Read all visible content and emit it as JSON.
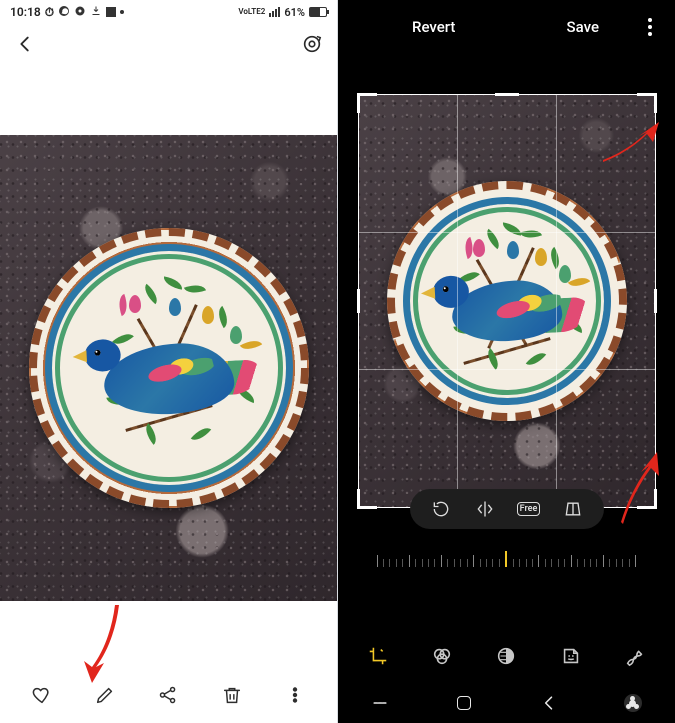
{
  "status": {
    "time": "10:18",
    "network_label": "VoLTE2",
    "signal_icon": "signal-icon",
    "battery_pct": "61%",
    "battery_icon": "battery-icon",
    "notif_icons": [
      "clock-icon",
      "whatsapp-icon",
      "disc-icon",
      "download-icon",
      "square-icon",
      "more-dot"
    ]
  },
  "left": {
    "back_icon": "chevron-left-icon",
    "bixby_icon": "bixby-vision-icon",
    "actions": {
      "favorite": "heart-icon",
      "edit": "pencil-icon",
      "share": "share-icon",
      "delete": "trash-icon",
      "more": "more-vertical-icon"
    }
  },
  "editor": {
    "revert_label": "Revert",
    "save_label": "Save",
    "more_icon": "more-vertical-icon",
    "pill": {
      "rotate": "rotate-ccw-icon",
      "flip": "flip-horizontal-icon",
      "ratio_label": "Free",
      "perspective": "perspective-icon"
    },
    "ruler_center_color": "#f2c827",
    "modes": {
      "transform": "crop-rotate-icon",
      "filters": "filters-icon",
      "tone": "tone-icon",
      "stickers": "sticker-icon",
      "draw": "draw-icon"
    }
  },
  "nav": {
    "recents": "recents-icon",
    "home": "home-icon",
    "back": "back-icon",
    "accessibility": "accessibility-icon"
  }
}
